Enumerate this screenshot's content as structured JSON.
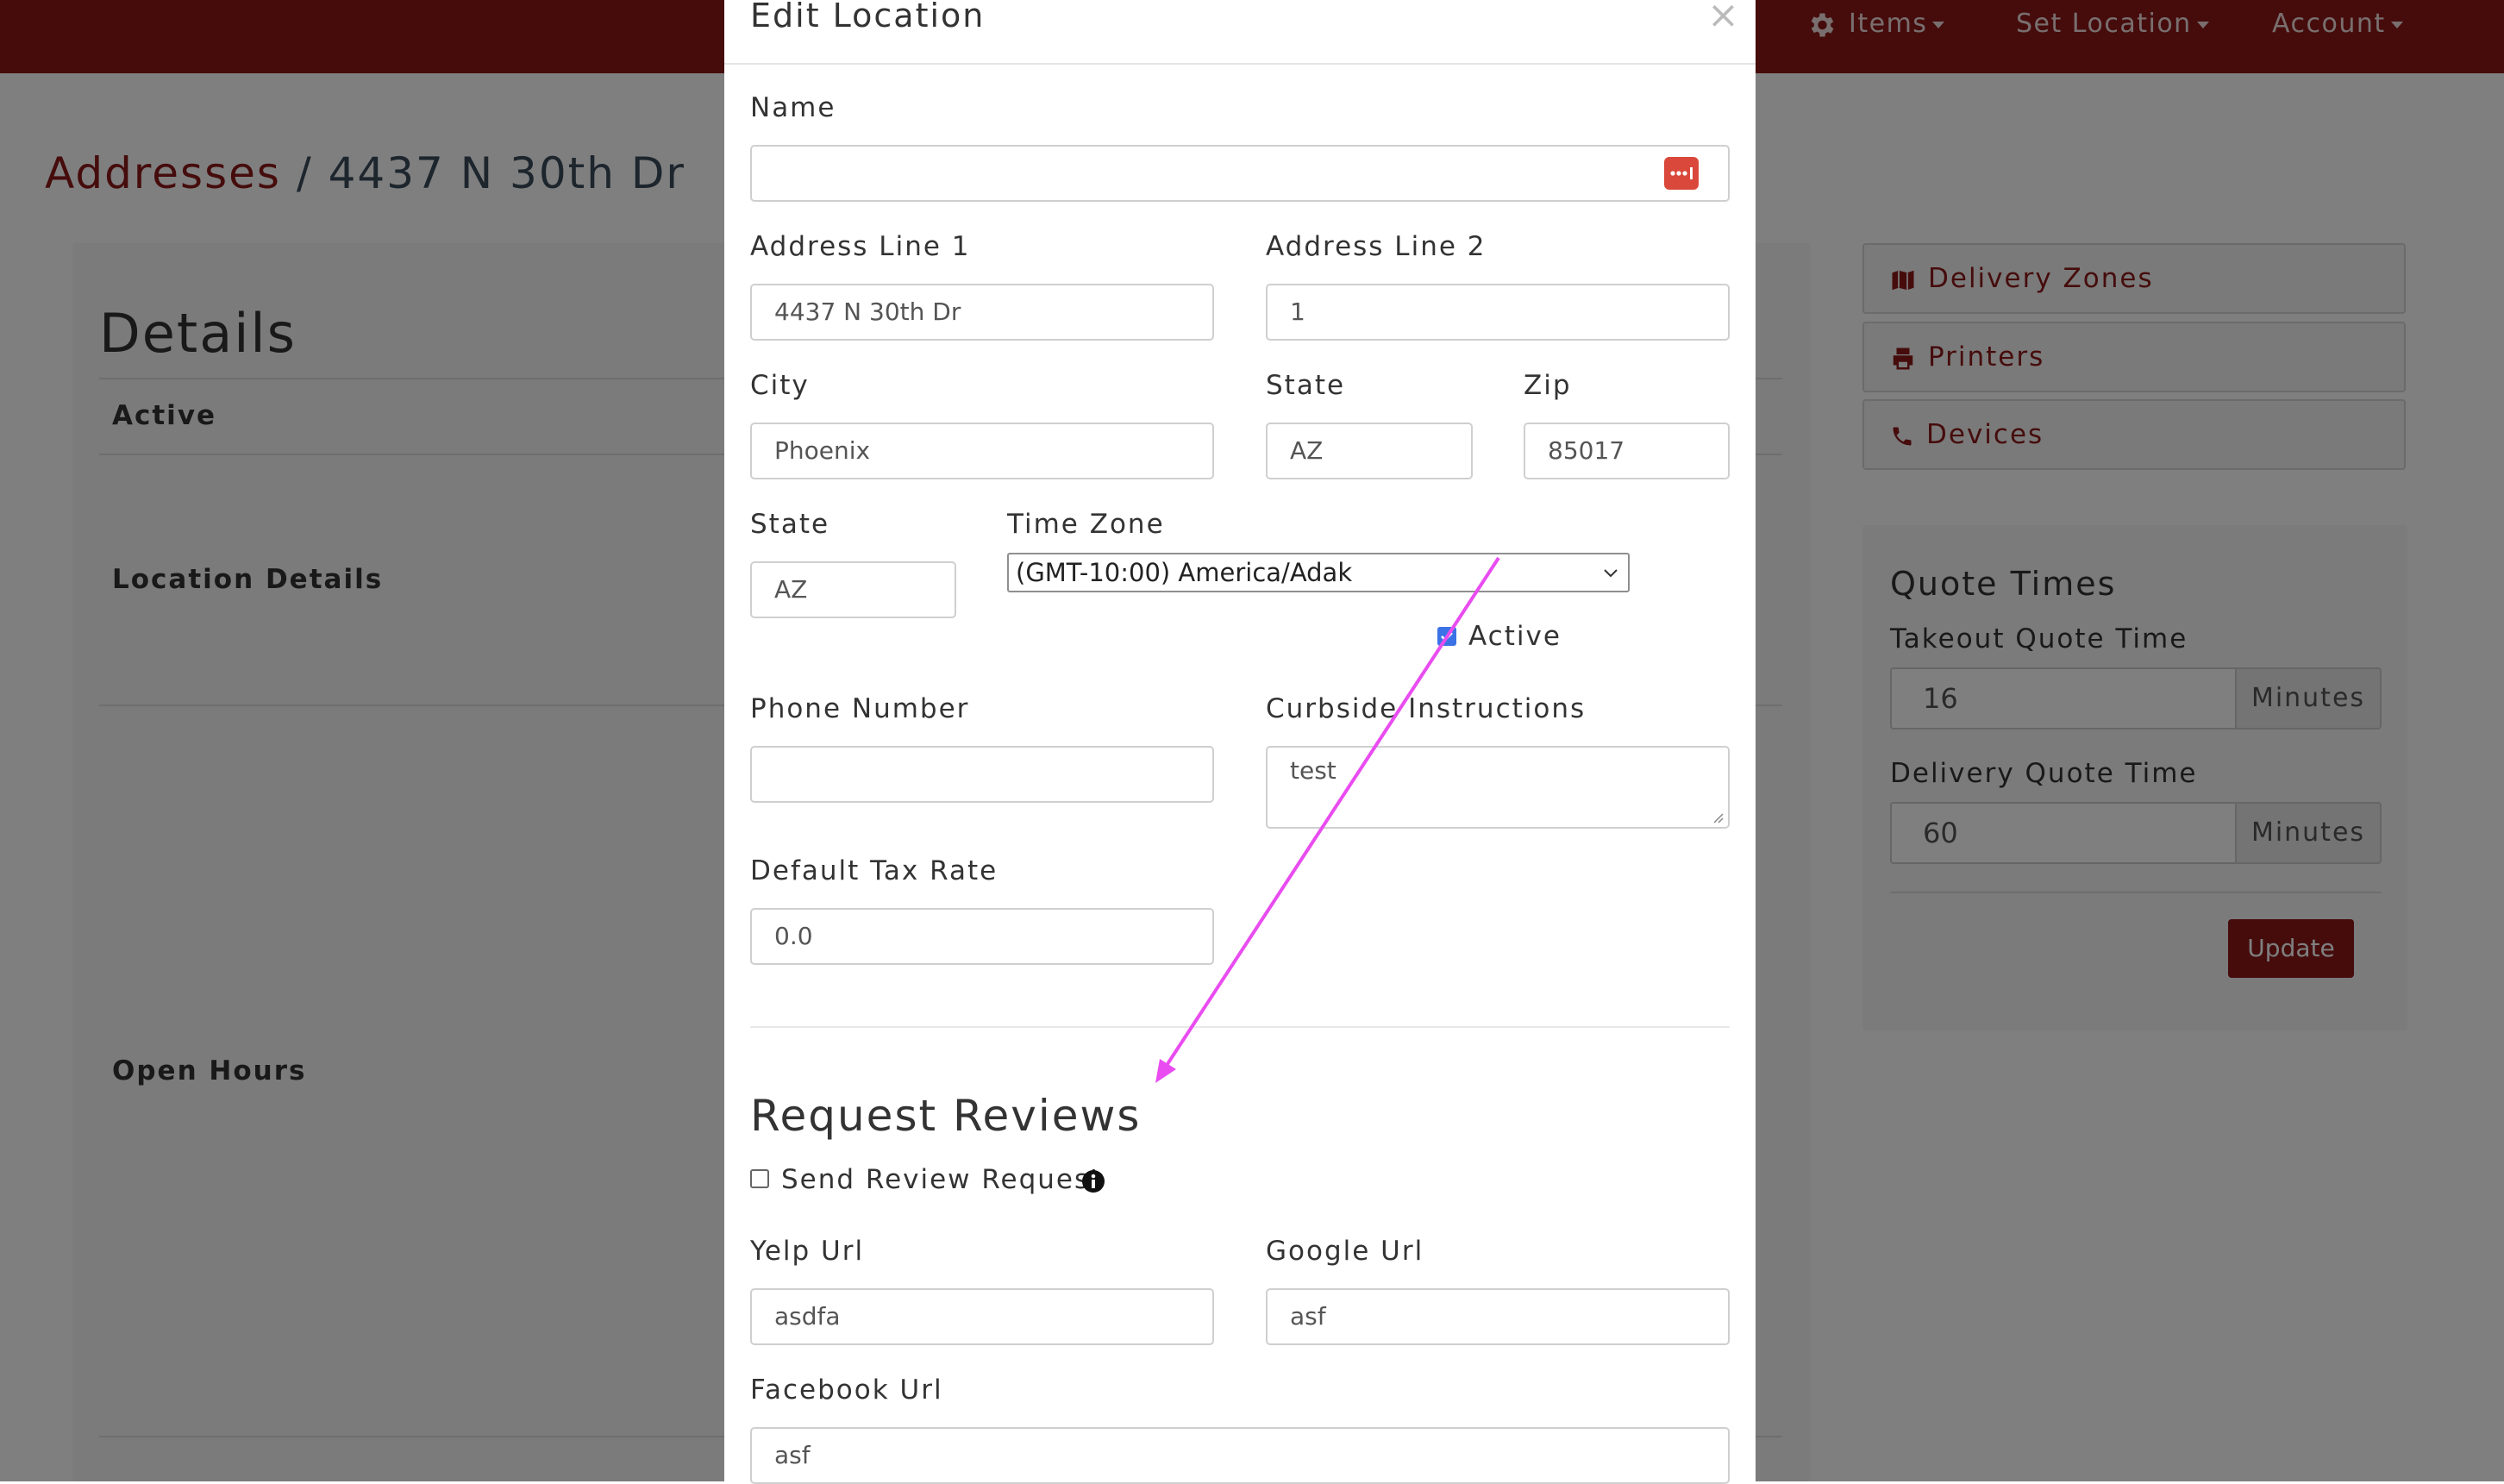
{
  "nav": {
    "items_label": "Items",
    "set_location_label": "Set Location",
    "account_label": "Account"
  },
  "breadcrumb": {
    "link": "Addresses",
    "separator": "/",
    "current": "4437 N 30th Dr"
  },
  "details": {
    "title": "Details",
    "rows": [
      "Active",
      "Location Details",
      "Open Hours"
    ]
  },
  "sidebar": {
    "delivery_zones": "Delivery Zones",
    "printers": "Printers",
    "devices": "Devices"
  },
  "quote_times": {
    "title": "Quote Times",
    "takeout_label": "Takeout Quote Time",
    "takeout_value": "16",
    "delivery_label": "Delivery Quote Time",
    "delivery_value": "60",
    "unit": "Minutes",
    "update_label": "Update"
  },
  "modal": {
    "title": "Edit Location",
    "close": "×",
    "name_label": "Name",
    "name_value": "",
    "address1_label": "Address Line 1",
    "address1_value": "4437 N 30th Dr",
    "address2_label": "Address Line 2",
    "address2_value": "1",
    "city_label": "City",
    "city_value": "Phoenix",
    "state_label": "State",
    "state_value": "AZ",
    "zip_label": "Zip",
    "zip_value": "85017",
    "state2_label": "State",
    "state2_value": "AZ",
    "timezone_label": "Time Zone",
    "timezone_value": "(GMT-10:00) America/Adak",
    "active_label": "Active",
    "active_checked": true,
    "phone_label": "Phone Number",
    "phone_value": "",
    "curbside_label": "Curbside Instructions",
    "curbside_value": "test",
    "tax_label": "Default Tax Rate",
    "tax_value": "0.0",
    "reviews_title": "Request Reviews",
    "send_review_label": "Send Review Request",
    "send_review_checked": false,
    "yelp_label": "Yelp Url",
    "yelp_value": "asdfa",
    "google_label": "Google Url",
    "google_value": "asf",
    "facebook_label": "Facebook Url",
    "facebook_value": "asf"
  },
  "colors": {
    "brand": "#8c1818",
    "annotation_arrow": "#e94cf0",
    "checkbox_checked": "#3b73e6"
  }
}
